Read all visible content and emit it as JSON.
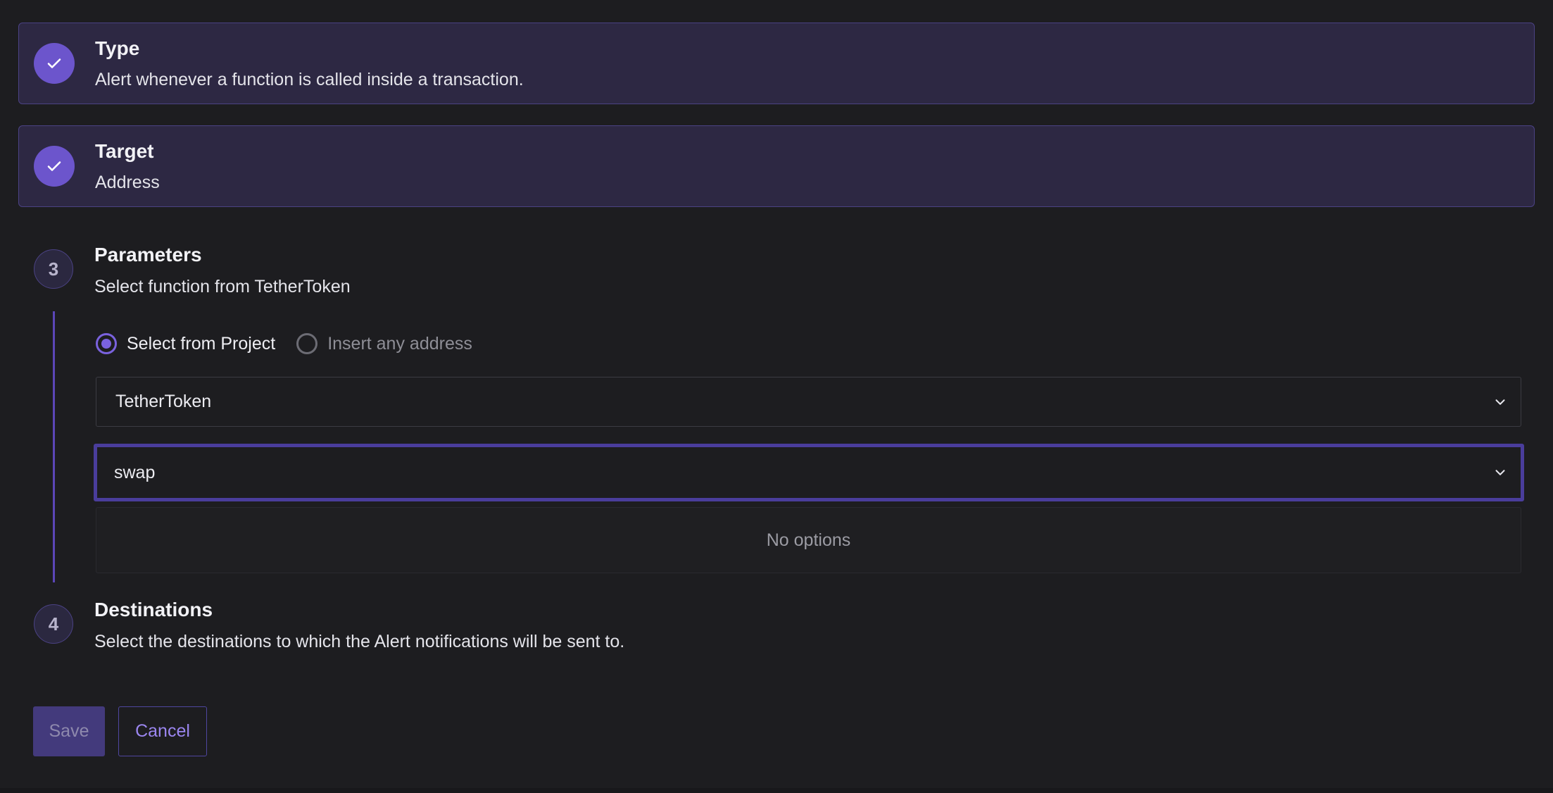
{
  "steps": {
    "type": {
      "title": "Type",
      "subtitle": "Alert whenever a function is called inside a transaction.",
      "status": "complete"
    },
    "target": {
      "title": "Target",
      "subtitle": "Address",
      "status": "complete"
    },
    "parameters": {
      "number": "3",
      "title": "Parameters",
      "subtitle": "Select function from TetherToken",
      "radio_options": [
        {
          "label": "Select from Project",
          "selected": true
        },
        {
          "label": "Insert any address",
          "selected": false
        }
      ],
      "contract_select": {
        "value": "TetherToken"
      },
      "function_select": {
        "value": "swap",
        "focused": true
      },
      "dropdown_menu": {
        "empty_text": "No options"
      }
    },
    "destinations": {
      "number": "4",
      "title": "Destinations",
      "subtitle": "Select the destinations to which the Alert notifications will be sent to."
    }
  },
  "actions": {
    "save_label": "Save",
    "cancel_label": "Cancel"
  },
  "colors": {
    "accent": "#6c55cc",
    "card_bg": "#2d2843",
    "page_bg": "#1d1d20",
    "focus_border": "#4a3d9c"
  },
  "icons": {
    "complete": "check-icon",
    "select": "chevron-down-icon"
  }
}
